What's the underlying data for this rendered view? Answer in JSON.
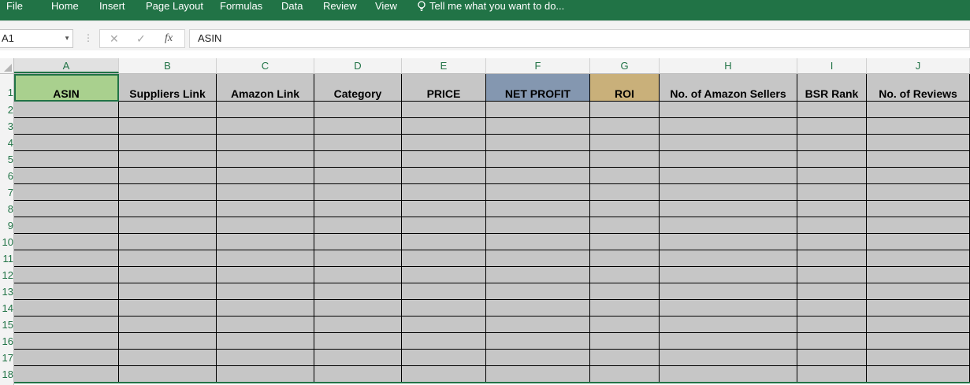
{
  "ribbon": {
    "tabs": [
      "File",
      "Home",
      "Insert",
      "Page Layout",
      "Formulas",
      "Data",
      "Review",
      "View"
    ],
    "tell_me": "Tell me what you want to do...",
    "color": "#217346"
  },
  "formula_bar": {
    "name_box": "A1",
    "cancel_icon": "✕",
    "enter_icon": "✓",
    "fx_label": "fx",
    "formula": "ASIN"
  },
  "sheet": {
    "columns": [
      "A",
      "B",
      "C",
      "D",
      "E",
      "F",
      "G",
      "H",
      "I",
      "J"
    ],
    "rows": [
      "1",
      "2",
      "3",
      "4",
      "5",
      "6",
      "7",
      "8",
      "9",
      "10",
      "11",
      "12",
      "13",
      "14",
      "15",
      "16",
      "17",
      "18"
    ],
    "selected_cell": "A1",
    "headers": [
      "ASIN",
      "Suppliers Link",
      "Amazon Link",
      "Category",
      "PRICE",
      "NET PROFIT",
      "ROI",
      "No. of Amazon Sellers",
      "BSR Rank",
      "No. of Reviews"
    ],
    "header_fills": [
      "#a9d08e",
      "#c6c6c6",
      "#c6c6c6",
      "#c6c6c6",
      "#c6c6c6",
      "#8497b0",
      "#c9b07a",
      "#c6c6c6",
      "#c6c6c6",
      "#c6c6c6"
    ],
    "body_fill": "#c6c6c6"
  }
}
